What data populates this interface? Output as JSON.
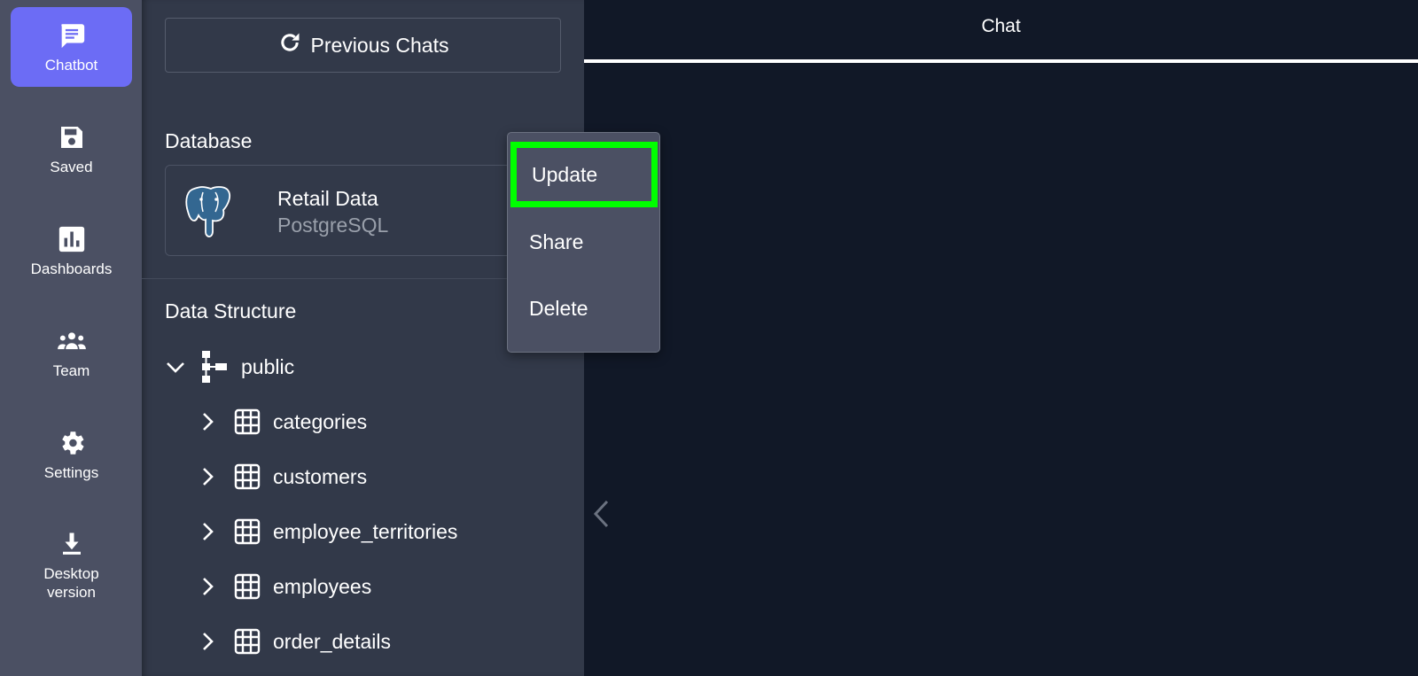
{
  "rail": {
    "items": [
      {
        "label": "Chatbot",
        "icon": "chat-icon"
      },
      {
        "label": "Saved",
        "icon": "save-icon"
      },
      {
        "label": "Dashboards",
        "icon": "bar-chart-icon"
      },
      {
        "label": "Team",
        "icon": "team-icon"
      },
      {
        "label": "Settings",
        "icon": "gear-icon"
      },
      {
        "label": "Desktop\nversion",
        "icon": "download-icon"
      }
    ],
    "active_color": "#6c6cf5"
  },
  "panel": {
    "previous_chats_label": "Previous Chats",
    "database_heading": "Database",
    "database": {
      "name": "Retail Data",
      "type": "PostgreSQL"
    },
    "structure_heading": "Data Structure",
    "schema": "public",
    "tables": [
      "categories",
      "customers",
      "employee_territories",
      "employees",
      "order_details"
    ]
  },
  "main": {
    "title": "Chat"
  },
  "context_menu": {
    "items": [
      "Update",
      "Share",
      "Delete"
    ],
    "highlight_color": "#00ff00"
  }
}
